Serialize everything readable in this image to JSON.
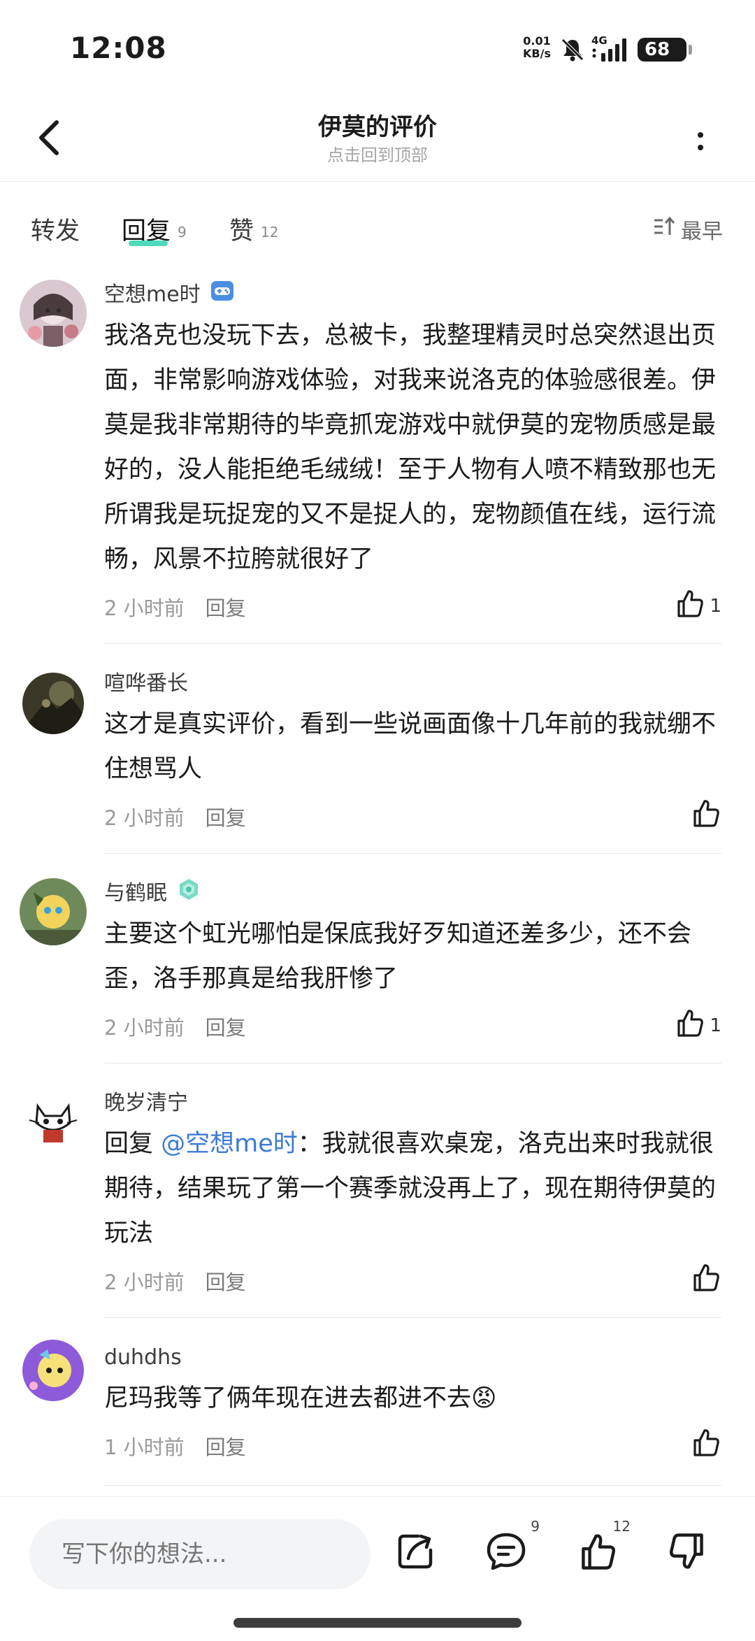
{
  "status_bar": {
    "time": "12:08",
    "net_speed_value": "0.01",
    "net_speed_unit": "KB/s",
    "network_type": "4G",
    "battery": "68"
  },
  "header": {
    "title": "伊莫的评价",
    "subtitle": "点击回到顶部"
  },
  "tabs": [
    {
      "label": "转发",
      "count": ""
    },
    {
      "label": "回复",
      "count": "9"
    },
    {
      "label": "赞",
      "count": "12"
    }
  ],
  "sort": {
    "label": "最早"
  },
  "comments": [
    {
      "username": "空想me时",
      "text": "我洛克也没玩下去，总被卡，我整理精灵时总突然退出页面，非常影响游戏体验，对我来说洛克的体验感很差。伊莫是我非常期待的毕竟抓宠游戏中就伊莫的宠物质感是最好的，没人能拒绝毛绒绒！至于人物有人喷不精致那也无所谓我是玩捉宠的又不是捉人的，宠物颜值在线，运行流畅，风景不拉胯就很好了",
      "time": "2 小时前",
      "reply_label": "回复",
      "likes": "1"
    },
    {
      "username": "喧哗番长",
      "text": "这才是真实评价，看到一些说画面像十几年前的我就绷不住想骂人",
      "time": "2 小时前",
      "reply_label": "回复",
      "likes": ""
    },
    {
      "username": "与鹤眠",
      "text": "主要这个虹光哪怕是保底我好歹知道还差多少，还不会歪，洛手那真是给我肝惨了",
      "time": "2 小时前",
      "reply_label": "回复",
      "likes": "1"
    },
    {
      "username": "晚岁清宁",
      "reply_prefix": "回复 ",
      "mention": "@空想me时",
      "text": "：我就很喜欢桌宠，洛克出来时我就很期待，结果玩了第一个赛季就没再上了，现在期待伊莫的玩法",
      "time": "2 小时前",
      "reply_label": "回复",
      "likes": ""
    },
    {
      "username": "duhdhs",
      "text": "尼玛我等了俩年现在进去都进不去😡",
      "time": "1 小时前",
      "reply_label": "回复",
      "likes": ""
    }
  ],
  "bottom_bar": {
    "input_placeholder": "写下你的想法...",
    "comment_count": "9",
    "like_count": "12"
  }
}
